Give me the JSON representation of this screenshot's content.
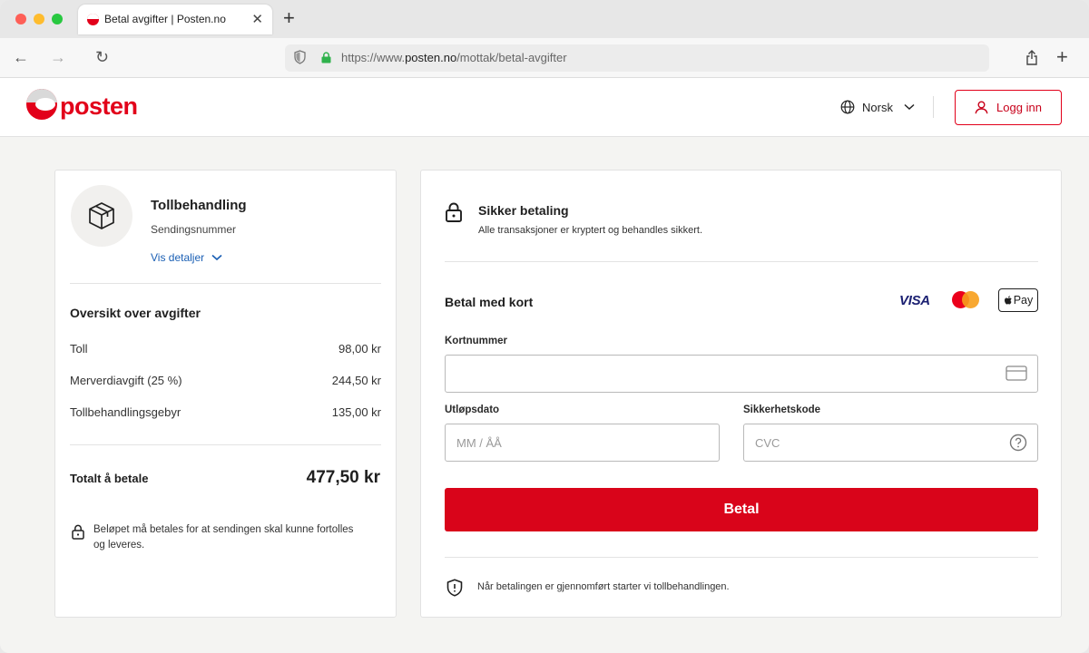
{
  "browser": {
    "tab_title": "Betal avgifter | Posten.no",
    "url_prefix": "https://www.",
    "url_domain": "posten.no",
    "url_path": "/mottak/betal-avgifter"
  },
  "header": {
    "logo_text": "posten",
    "language": "Norsk",
    "login_label": "Logg inn",
    "brand_color": "#e2001a"
  },
  "shipment": {
    "title": "Tollbehandling",
    "subtitle": "Sendingsnummer",
    "details_link": "Vis detaljer"
  },
  "fees": {
    "heading": "Oversikt over avgifter",
    "items": [
      {
        "label": "Toll",
        "amount": "98,00 kr"
      },
      {
        "label": "Merverdiavgift (25 %)",
        "amount": "244,50 kr"
      },
      {
        "label": "Tollbehandlingsgebyr",
        "amount": "135,00 kr"
      }
    ],
    "total_label": "Totalt å betale",
    "total_amount": "477,50 kr",
    "note": "Beløpet må betales for at sendingen skal kunne fortolles og leveres."
  },
  "payment": {
    "secure_title": "Sikker betaling",
    "secure_sub": "Alle transaksjoner er kryptert og behandles sikkert.",
    "card_title": "Betal med kort",
    "visa_label": "VISA",
    "applepay_label": "Pay",
    "card_number_label": "Kortnummer",
    "card_number_value": "",
    "expiry_label": "Utløpsdato",
    "expiry_placeholder": "MM / ÅÅ",
    "cvc_label": "Sikkerhetskode",
    "cvc_placeholder": "CVC",
    "pay_button": "Betal",
    "footer_note": "Når betalingen er gjennomført starter vi tollbehandlingen."
  }
}
